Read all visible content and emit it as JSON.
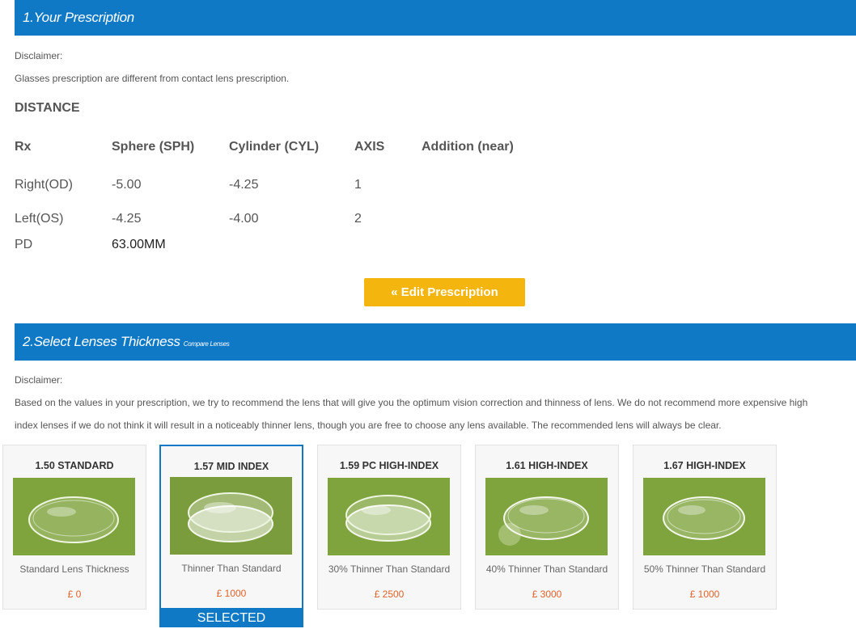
{
  "section1": {
    "title": "1.Your Prescription"
  },
  "disclaimer1": {
    "label": "Disclaimer:",
    "text": "Glasses prescription are different from contact lens prescription."
  },
  "distance_label": "DISTANCE",
  "rx_table": {
    "headers": [
      "Rx",
      "Sphere (SPH)",
      "Cylinder (CYL)",
      "AXIS",
      "Addition (near)"
    ],
    "rows": [
      {
        "label": "Right(OD)",
        "sph": "-5.00",
        "cyl": "-4.25",
        "axis": "1"
      },
      {
        "label": "Left(OS)",
        "sph": "-4.25",
        "cyl": "-4.00",
        "axis": "2"
      }
    ],
    "pd_label": "PD",
    "pd_value": "63.00MM"
  },
  "edit_button": "« Edit Prescription",
  "section2": {
    "title": "2.Select Lenses Thickness",
    "compare_link": "Compare Lenses"
  },
  "disclaimer2": {
    "label": "Disclaimer:",
    "line1": "Based on the values in your prescription, we try to recommend the lens that will give you the optimum vision correction and thinness of lens. We do not recommend more expensive high",
    "line2": "index lenses if we do not think it will result in a noticeably thinner lens, though you are free to choose any lens available. The recommended lens will always be clear."
  },
  "lenses": [
    {
      "title": "1.50 STANDARD",
      "desc": "Standard Lens Thickness",
      "price": "£ 0"
    },
    {
      "title": "1.57 MID INDEX",
      "desc": "Thinner Than Standard",
      "price": "£ 1000"
    },
    {
      "title": "1.59 PC HIGH-INDEX",
      "desc": "30% Thinner Than Standard",
      "price": "£ 2500"
    },
    {
      "title": "1.61 HIGH-INDEX",
      "desc": "40% Thinner Than Standard",
      "price": "£ 3000"
    },
    {
      "title": "1.67 HIGH-INDEX",
      "desc": "50% Thinner Than Standard",
      "price": "£ 1000"
    }
  ],
  "selected_label": "SELECTED",
  "colors": {
    "header_blue": "#1079c6",
    "button_yellow": "#f5b50f",
    "price_orange": "#e0622c",
    "lens_bg_green": "#7fa43e"
  }
}
